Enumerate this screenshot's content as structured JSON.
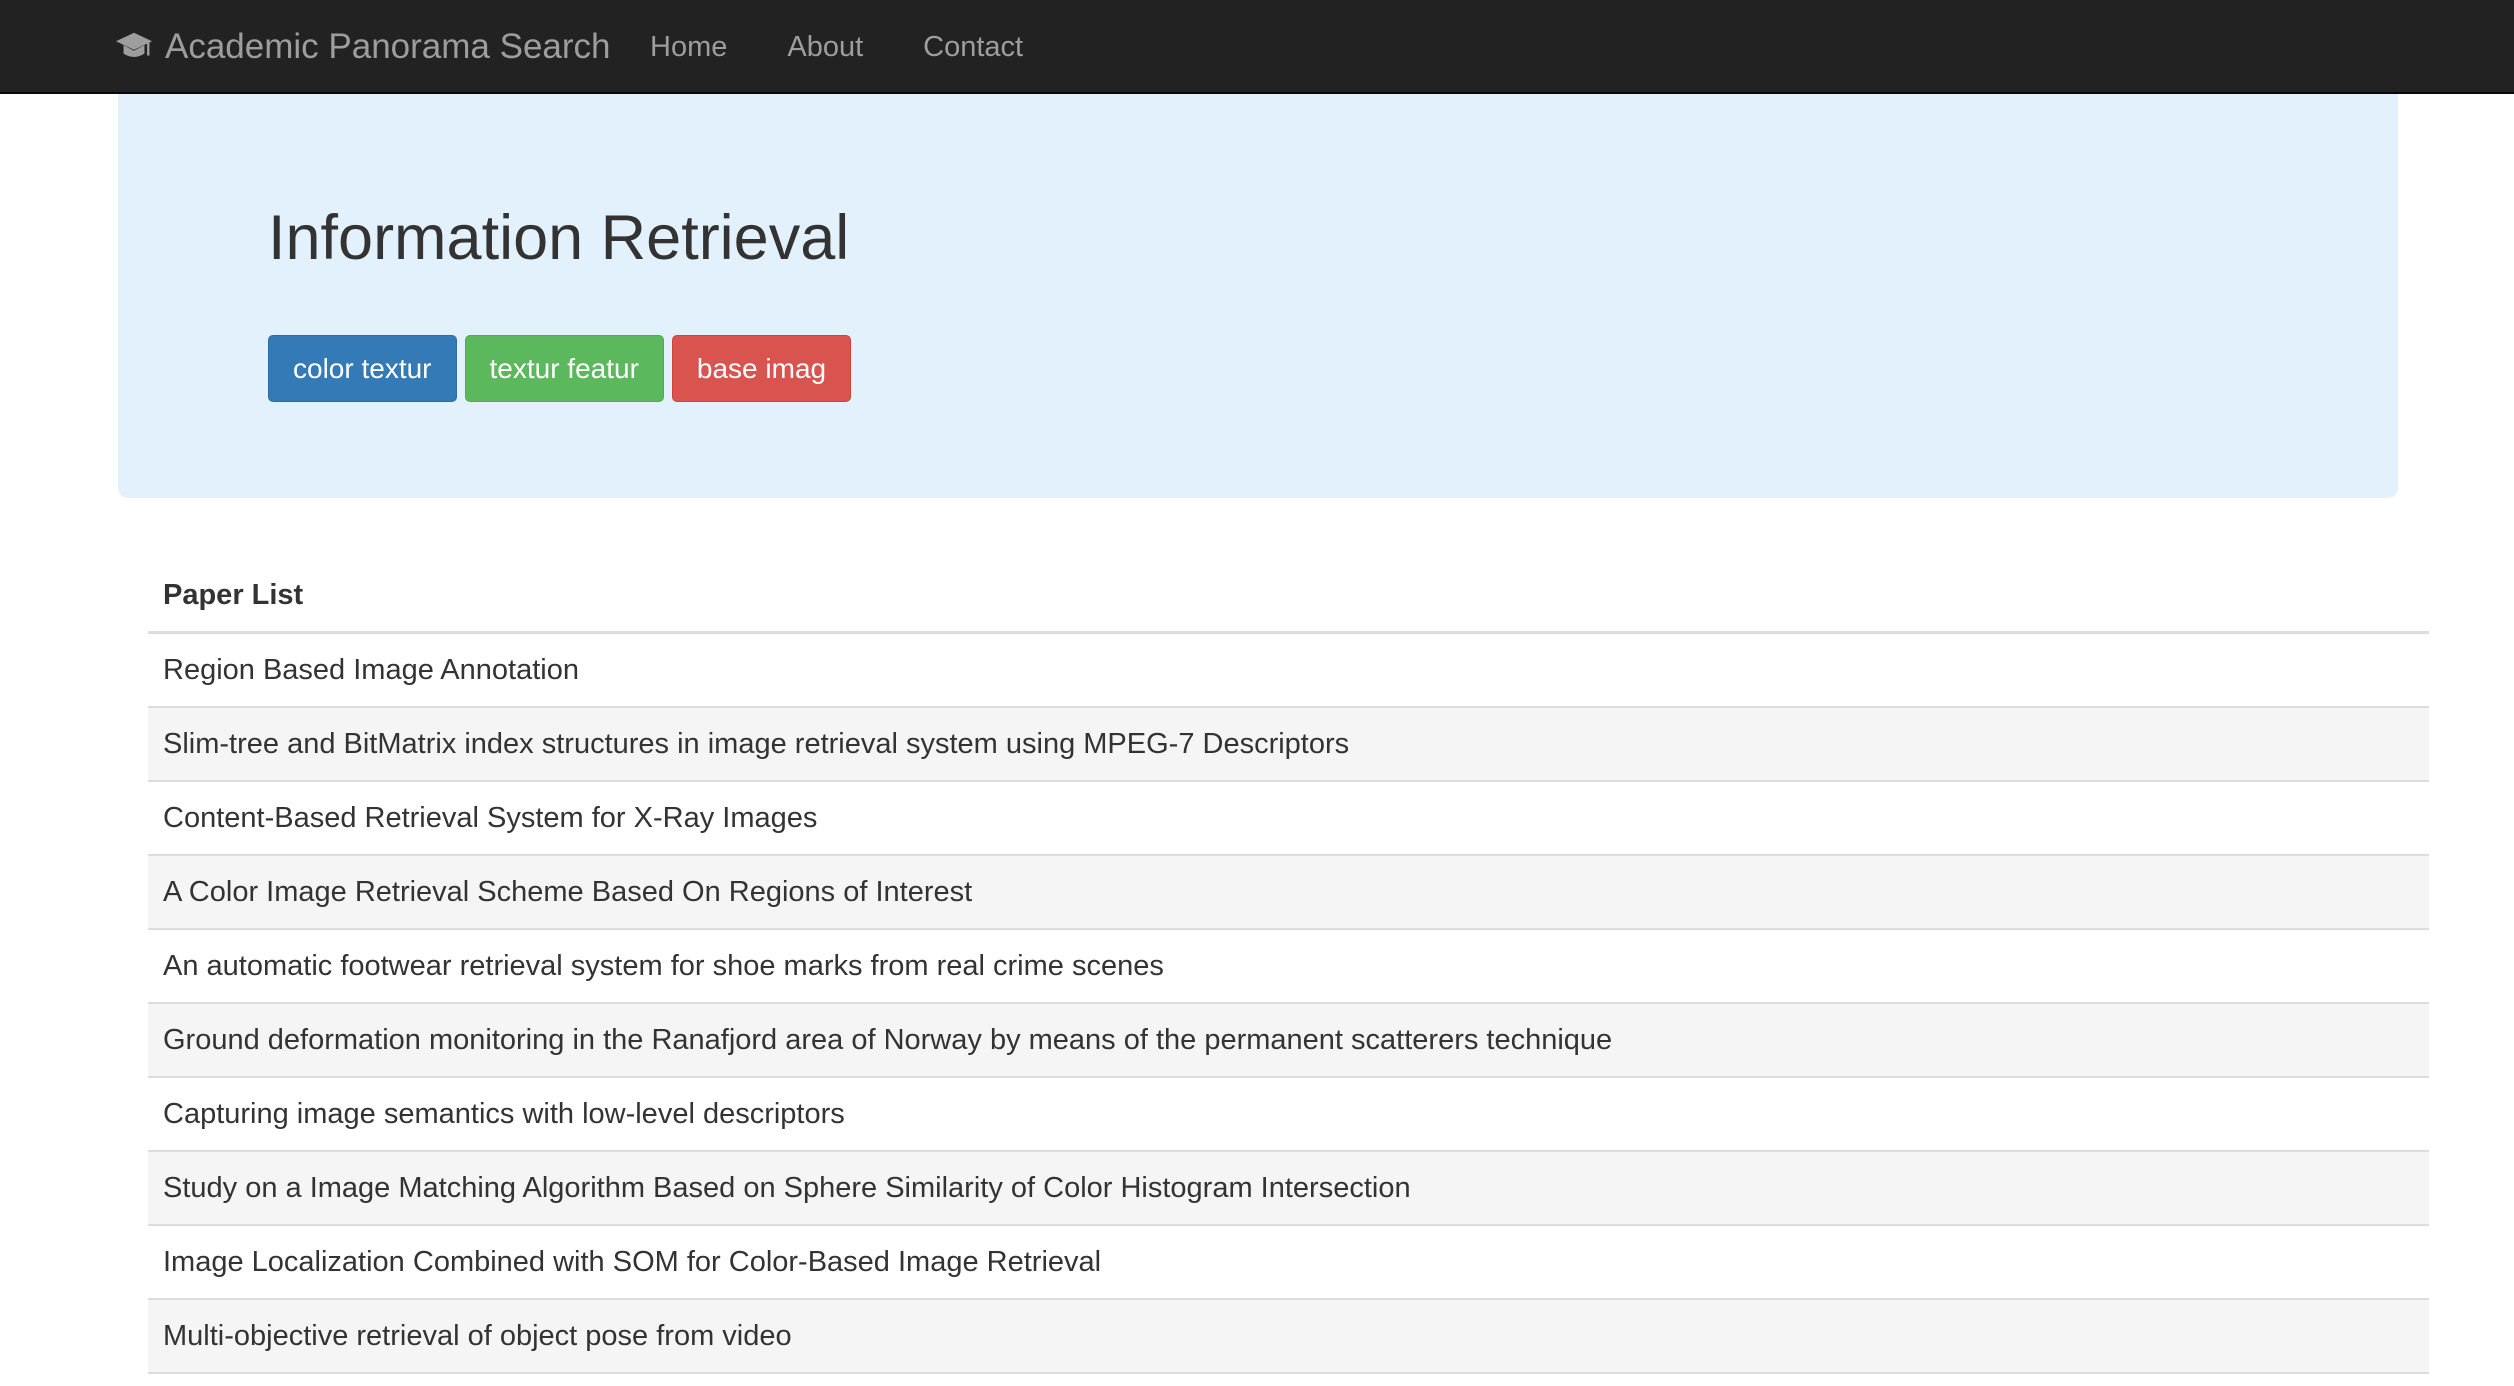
{
  "navbar": {
    "brand": "Academic Panorama Search",
    "brand_icon": "graduation-cap-icon",
    "links": [
      "Home",
      "About",
      "Contact"
    ]
  },
  "jumbotron": {
    "title": "Information Retrieval",
    "tags": [
      {
        "label": "color textur",
        "color": "#337ab7"
      },
      {
        "label": "textur featur",
        "color": "#5cb85c"
      },
      {
        "label": "base imag",
        "color": "#d9534f"
      }
    ]
  },
  "paper_list": {
    "header": "Paper List",
    "rows": [
      "Region Based Image Annotation",
      "Slim-tree and BitMatrix index structures in image retrieval system using MPEG-7 Descriptors",
      "Content-Based Retrieval System for X-Ray Images",
      "A Color Image Retrieval Scheme Based On Regions of Interest",
      "An automatic footwear retrieval system for shoe marks from real crime scenes",
      "Ground deformation monitoring in the Ranafjord area of Norway by means of the permanent scatterers technique",
      "Capturing image semantics with low-level descriptors",
      "Study on a Image Matching Algorithm Based on Sphere Similarity of Color Histogram Intersection",
      "Image Localization Combined with SOM for Color-Based Image Retrieval",
      "Multi-objective retrieval of object pose from video"
    ]
  }
}
